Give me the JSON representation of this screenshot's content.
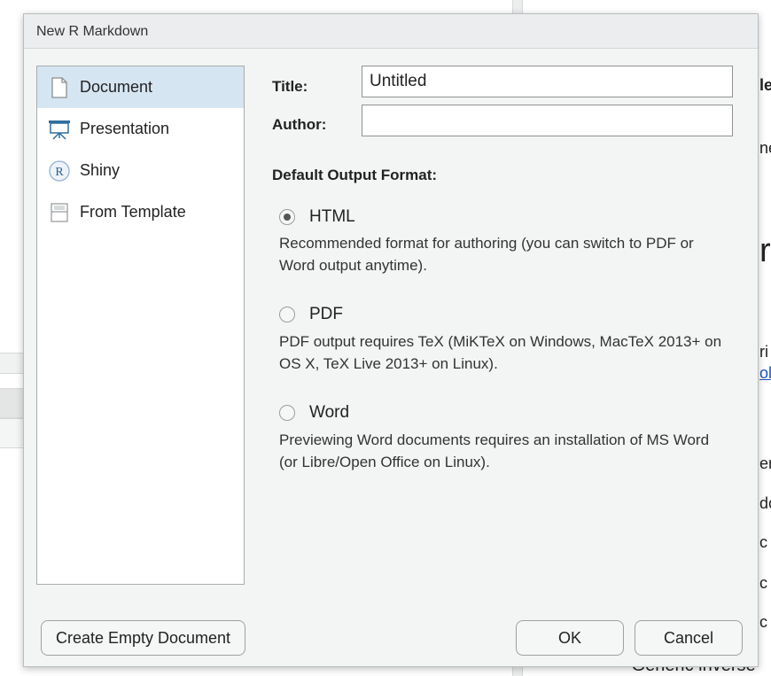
{
  "dialog": {
    "title": "New R Markdown"
  },
  "sidebar": {
    "items": [
      {
        "label": "Document",
        "icon": "document-icon",
        "selected": true
      },
      {
        "label": "Presentation",
        "icon": "presentation-icon",
        "selected": false
      },
      {
        "label": "Shiny",
        "icon": "shiny-r-icon",
        "selected": false
      },
      {
        "label": "From Template",
        "icon": "template-icon",
        "selected": false
      }
    ]
  },
  "form": {
    "title_label": "Title:",
    "title_value": "Untitled",
    "author_label": "Author:",
    "author_value": "",
    "output_format_label": "Default Output Format:",
    "options": [
      {
        "label": "HTML",
        "checked": true,
        "description": "Recommended format for authoring (you can switch to PDF or Word output anytime)."
      },
      {
        "label": "PDF",
        "checked": false,
        "description": "PDF output requires TeX (MiKTeX on Windows, MacTeX 2013+ on OS X, TeX Live 2013+ on Linux)."
      },
      {
        "label": "Word",
        "checked": false,
        "description": "Previewing Word documents requires an installation of MS Word (or Libre/Open Office on Linux)."
      }
    ]
  },
  "buttons": {
    "create_empty": "Create Empty Document",
    "ok": "OK",
    "cancel": "Cancel"
  },
  "background": {
    "fragments": [
      "le",
      "ne",
      "r",
      "ri",
      "ol",
      "er",
      "do",
      "c",
      "c",
      "c"
    ],
    "bottom_text": "• Generic inverse"
  },
  "colors": {
    "selected_item_bg": "#d6e5f2",
    "dialog_bg": "#f3f4f4",
    "link": "#1a56c4"
  }
}
